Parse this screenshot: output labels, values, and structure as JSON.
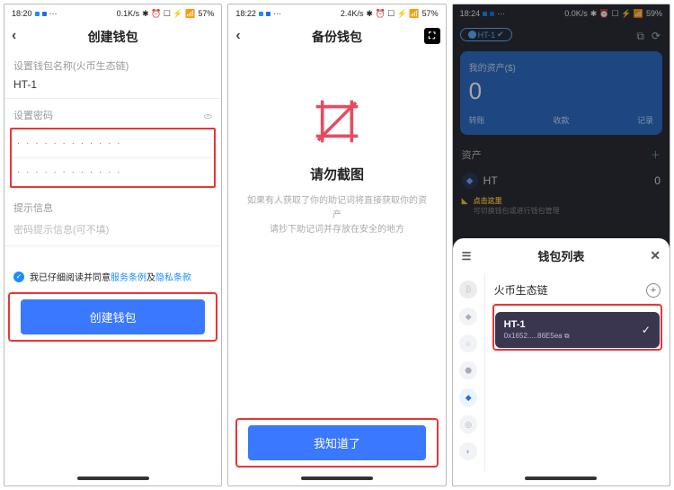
{
  "screen1": {
    "statusbar": {
      "time": "18:20",
      "net": "0.1K/s",
      "icons": "✱ ⏰ ☐ ⚡ 📶",
      "battery": "57%"
    },
    "title": "创建钱包",
    "name_section_label": "设置钱包名称(火币生态链)",
    "wallet_name": "HT-1",
    "password_label": "设置密码",
    "pw1": "· · · · · · · · · · · ·",
    "pw2": "· · · · · · · · · · · ·",
    "hint_section_label": "提示信息",
    "hint_placeholder": "密码提示信息(可不填)",
    "agree_text": "我已仔细阅读并同意",
    "tos": "服务条例",
    "and": "及",
    "privacy": "隐私条款",
    "create_btn": "创建钱包"
  },
  "screen2": {
    "statusbar": {
      "time": "18:22",
      "net": "2.4K/s",
      "icons": "✱ ⏰ ☐ ⚡ 📶",
      "battery": "57%"
    },
    "title": "备份钱包",
    "heading": "请勿截图",
    "desc1": "如果有人获取了你的助记词将直接获取你的资产",
    "desc2": "请抄下助记词并存放在安全的地方",
    "ok_btn": "我知道了"
  },
  "screen3": {
    "statusbar": {
      "time": "18:24",
      "net": "0.0K/s",
      "icons": "✱ ⏰ ☐ ⚡ 📶",
      "battery": "59%"
    },
    "chip": "HT-1",
    "card": {
      "label": "我的资产($)",
      "value": "0",
      "a": "转账",
      "b": "收款",
      "c": "记录"
    },
    "assets_label": "资产",
    "ht_symbol": "HT",
    "ht_value": "0",
    "tip_title": "点击这里",
    "tip_sub": "可切换钱包或进行钱包管理",
    "sheet": {
      "title": "钱包列表",
      "chain": "火币生态链",
      "wallet_name": "HT-1",
      "wallet_addr": "0x1652.....86E5ea"
    }
  }
}
